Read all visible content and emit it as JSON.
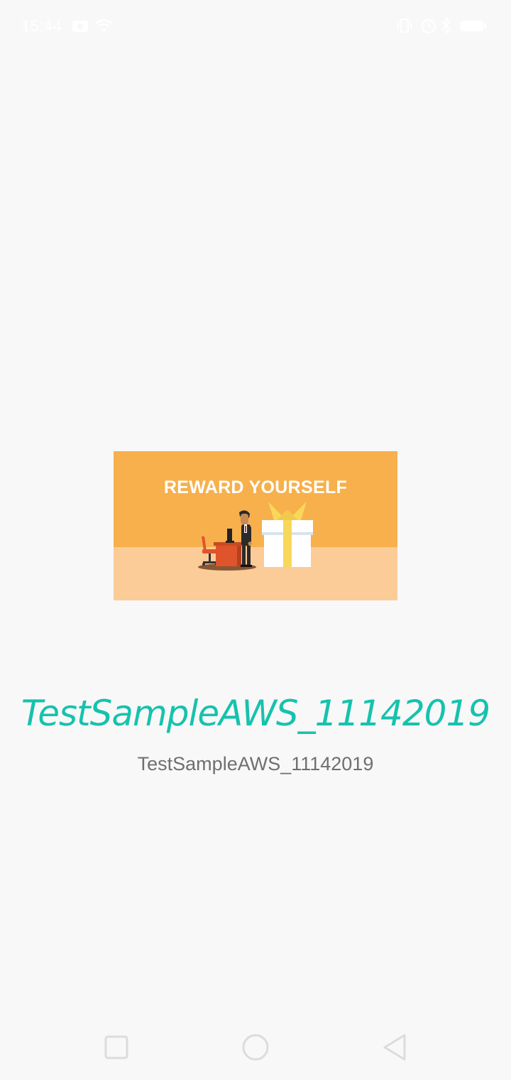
{
  "status_bar": {
    "time": "15:44",
    "icons": [
      "notification-icon",
      "wifi-icon",
      "vibrate-icon",
      "alarm-icon",
      "bluetooth-icon",
      "battery-icon"
    ]
  },
  "banner": {
    "title": "REWARD YOURSELF",
    "colors": {
      "top": "#f7b04c",
      "bottom": "#fbcb98"
    }
  },
  "app": {
    "title": "TestSampleAWS_11142019",
    "subtitle": "TestSampleAWS_11142019",
    "title_color": "#16c2ad"
  },
  "nav_bar": {
    "buttons": [
      "recents-button",
      "home-button",
      "back-button"
    ]
  }
}
